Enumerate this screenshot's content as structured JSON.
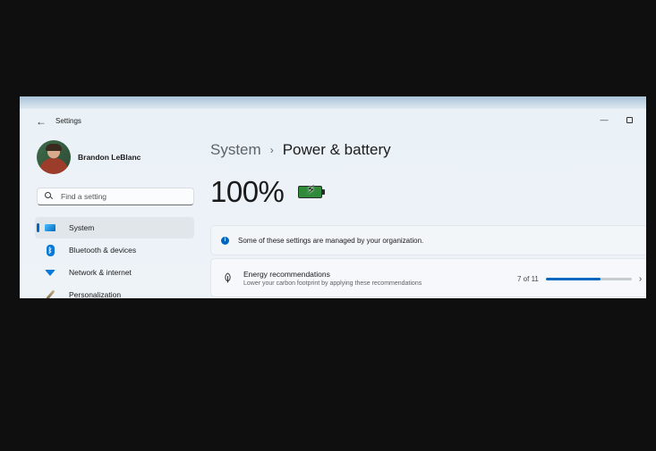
{
  "window": {
    "title": "Settings"
  },
  "user": {
    "name": "Brandon LeBlanc"
  },
  "search": {
    "placeholder": "Find a setting"
  },
  "sidebar": {
    "items": [
      {
        "label": "System",
        "icon": "system-icon",
        "active": true
      },
      {
        "label": "Bluetooth & devices",
        "icon": "bluetooth-icon",
        "active": false
      },
      {
        "label": "Network & internet",
        "icon": "wifi-icon",
        "active": false
      },
      {
        "label": "Personalization",
        "icon": "brush-icon",
        "active": false
      }
    ]
  },
  "breadcrumb": {
    "parent": "System",
    "separator": "›",
    "current": "Power & battery"
  },
  "battery": {
    "percent_text": "100%",
    "charging": true,
    "fill_color": "#2f8a3a"
  },
  "notice": {
    "text": "Some of these settings are managed by your organization."
  },
  "energy": {
    "title": "Energy recommendations",
    "subtitle": "Lower your carbon footprint by applying these recommendations",
    "count_text": "7 of 11",
    "progress_fraction": 0.636
  },
  "colors": {
    "accent": "#0067c0"
  }
}
